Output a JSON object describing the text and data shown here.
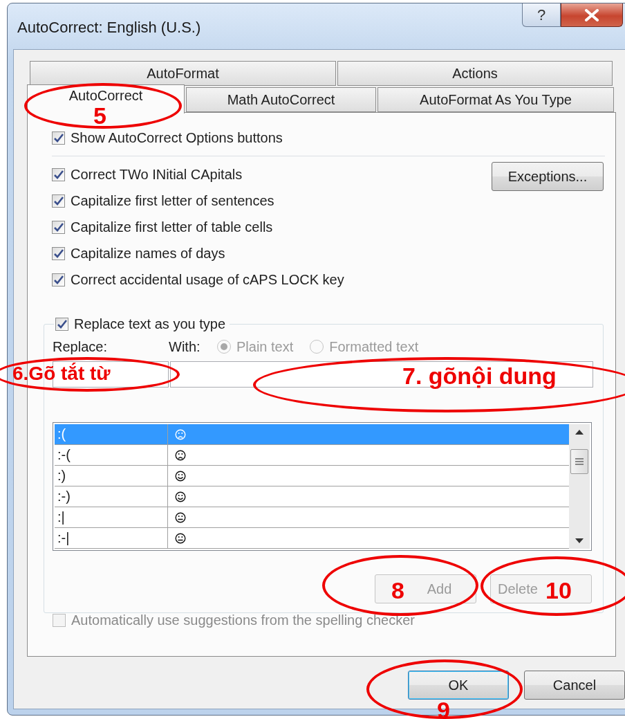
{
  "window": {
    "title": "AutoCorrect: English (U.S.)",
    "help_button": "?"
  },
  "tab_rows": [
    [
      {
        "label": "AutoFormat",
        "selected": false
      },
      {
        "label": "Actions",
        "selected": false
      }
    ],
    [
      {
        "label": "AutoCorrect",
        "selected": true,
        "annotation": "5"
      },
      {
        "label": "Math AutoCorrect",
        "selected": false
      },
      {
        "label": "AutoFormat As You Type",
        "selected": false
      }
    ]
  ],
  "show_options": {
    "label": "Show AutoCorrect Options buttons",
    "checked": true
  },
  "options": [
    {
      "label": "Correct TWo INitial CApitals",
      "checked": true
    },
    {
      "label": "Capitalize first letter of sentences",
      "checked": true
    },
    {
      "label": "Capitalize first letter of table cells",
      "checked": true
    },
    {
      "label": "Capitalize names of days",
      "checked": true
    },
    {
      "label": "Correct accidental usage of cAPS LOCK key",
      "checked": true
    }
  ],
  "exceptions_button": "Exceptions...",
  "replace_group": {
    "label": "Replace text as you type",
    "checked": true,
    "replace_label": "Replace:",
    "with_label": "With:",
    "format_options": [
      {
        "label": "Plain text",
        "selected": true,
        "disabled": true
      },
      {
        "label": "Formatted text",
        "selected": false,
        "disabled": true
      }
    ],
    "replace_field": {
      "annotation": "6.Gõ tắt từ"
    },
    "with_field": {
      "annotation": "7. gõnội dung"
    },
    "entries": [
      {
        "replace": ":(",
        "kind": "sad",
        "selected": true
      },
      {
        "replace": ":-(",
        "kind": "sad",
        "selected": false
      },
      {
        "replace": ":)",
        "kind": "smile",
        "selected": false
      },
      {
        "replace": ":-)",
        "kind": "smile",
        "selected": false
      },
      {
        "replace": ":|",
        "kind": "neutral",
        "selected": false
      },
      {
        "replace": ":-|",
        "kind": "neutral",
        "selected": false
      }
    ],
    "buttons": [
      {
        "label": "Add",
        "disabled": true,
        "annotation": "8"
      },
      {
        "label": "Delete",
        "disabled": true,
        "annotation": "10"
      }
    ],
    "suggestions": {
      "label": "Automatically use suggestions from the spelling checker",
      "checked": false,
      "disabled": true
    }
  },
  "footer_buttons": [
    {
      "label": "OK",
      "default": true,
      "annotation": "9"
    },
    {
      "label": "Cancel",
      "default": false
    }
  ]
}
